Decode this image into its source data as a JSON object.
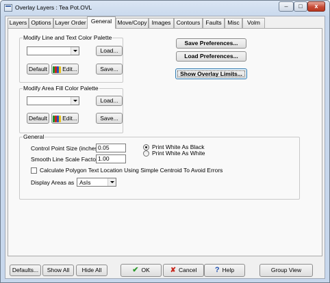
{
  "window": {
    "title": "Overlay Layers : Tea Pot.OVL",
    "controls": {
      "minimize": "–",
      "maximize": "□",
      "close": "x"
    }
  },
  "tabs": [
    {
      "label": "Layers",
      "active": false
    },
    {
      "label": "Options",
      "active": false
    },
    {
      "label": "Layer Order",
      "active": false
    },
    {
      "label": "General",
      "active": true
    },
    {
      "label": "Move/Copy",
      "active": false
    },
    {
      "label": "Images",
      "active": false
    },
    {
      "label": "Contours",
      "active": false
    },
    {
      "label": "Faults",
      "active": false
    },
    {
      "label": "Misc",
      "active": false
    },
    {
      "label": "Volm",
      "active": false
    }
  ],
  "line_palette": {
    "legend": "Modify Line and Text Color Palette",
    "selected": "",
    "load": "Load...",
    "default": "Default",
    "edit": "Edit...",
    "save": "Save..."
  },
  "area_palette": {
    "legend": "Modify Area Fill Color Palette",
    "selected": "",
    "load": "Load...",
    "default": "Default",
    "edit": "Edit...",
    "save": "Save..."
  },
  "preferences": {
    "save": "Save Preferences...",
    "load": "Load Preferences...",
    "show_limits": "Show Overlay Limits..."
  },
  "general": {
    "legend": "General",
    "control_point_label": "Control Point Size (inches)",
    "control_point_value": "0.05",
    "smooth_line_label": "Smooth Line Scale Factor",
    "smooth_line_value": "1.00",
    "print_black": "Print White As Black",
    "print_white": "Print White As White",
    "print_selected": "black",
    "centroid_label": "Calculate Polygon Text Location Using Simple Centroid To Avoid Errors",
    "centroid_checked": false,
    "display_areas_label": "Display Areas as",
    "display_areas_value": "AsIs"
  },
  "bottom": {
    "defaults": "Defaults...",
    "show_all": "Show All",
    "hide_all": "Hide All",
    "ok": "OK",
    "cancel": "Cancel",
    "help": "Help",
    "group_view": "Group View"
  },
  "palette_colors": [
    "#1a8f2a",
    "#d0211d",
    "#2452b8",
    "#e8c21a"
  ]
}
